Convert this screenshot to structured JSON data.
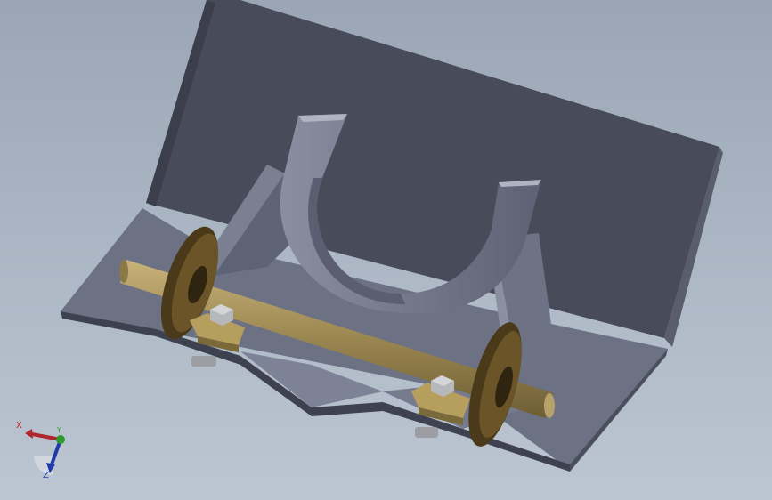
{
  "viewport": {
    "background_top": "#9aa6b5",
    "background_bottom": "#bcc6d2"
  },
  "model": {
    "parts": [
      "base-plate",
      "back-plate",
      "u-bracket",
      "gusset-left",
      "gusset-right",
      "rod",
      "washer-left",
      "washer-right",
      "nut-left",
      "nut-right",
      "shim-left",
      "shim-right"
    ],
    "colors": {
      "plate_face": "#5a5e6e",
      "plate_top": "#7c8194",
      "back_plate": "#484b59",
      "bracket": "#6f7386",
      "rod": "#9a8650",
      "washer": "#5c4a23",
      "bolt": "#b6b8bc"
    }
  },
  "triad": {
    "x_label": "X",
    "y_label": "Y",
    "z_label": "Z",
    "x_color": "#b0262e",
    "y_color": "#2e9a2e",
    "z_color": "#1f3aa8"
  }
}
